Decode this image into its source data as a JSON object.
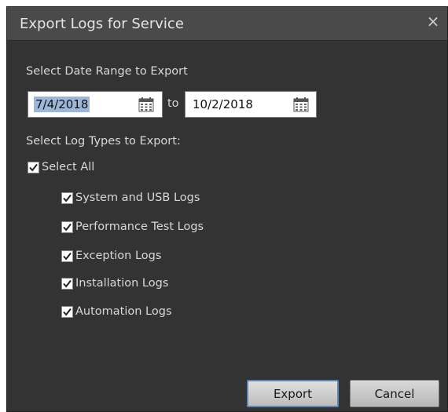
{
  "dialog": {
    "title": "Export Logs for Service",
    "close_glyph": "×"
  },
  "date_range": {
    "label": "Select Date Range to Export",
    "start": "7/4/2018",
    "to_label": "to",
    "end": "10/2/2018",
    "calendar_icon": "calendar-icon"
  },
  "log_types": {
    "label": "Select Log Types to Export:",
    "select_all": {
      "label": "Select All",
      "checked": true
    },
    "items": [
      {
        "label": "System and USB Logs",
        "checked": true
      },
      {
        "label": "Performance Test Logs",
        "checked": true
      },
      {
        "label": "Exception Logs",
        "checked": true
      },
      {
        "label": "Installation Logs",
        "checked": true
      },
      {
        "label": "Automation Logs",
        "checked": true
      }
    ]
  },
  "buttons": {
    "export": "Export",
    "cancel": "Cancel"
  },
  "colors": {
    "dialog_bg": "#333333",
    "titlebar_bg": "#4a4a4a",
    "selection": "#9db7d8",
    "primary_border": "#5e88b3"
  }
}
